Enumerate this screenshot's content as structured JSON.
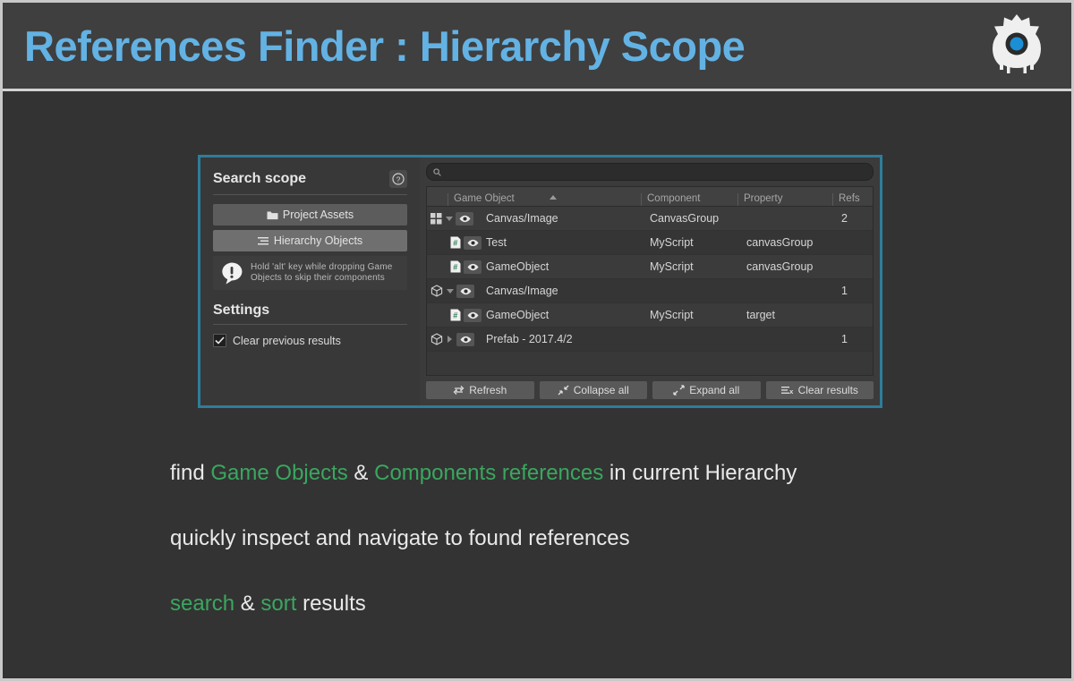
{
  "header": {
    "title": "References Finder : Hierarchy Scope",
    "title_color": "#63b2e4",
    "logo_icon": "robot-gear-head-icon",
    "logo_eye_color": "#1b8fd6"
  },
  "scope_panel": {
    "title": "Search scope",
    "help_icon": "question-mark-circle-icon",
    "buttons": [
      {
        "label": "Project Assets",
        "icon": "folder-icon",
        "selected": false
      },
      {
        "label": "Hierarchy Objects",
        "icon": "hierarchy-list-icon",
        "selected": true
      }
    ],
    "hint": {
      "icon": "exclamation-bubble-icon",
      "line1": "Hold 'alt' key while dropping Game",
      "line2": "Objects to skip their components"
    },
    "settings_title": "Settings",
    "settings": [
      {
        "label": "Clear previous results",
        "checked": true
      }
    ]
  },
  "results_panel": {
    "search": {
      "icon": "search-icon",
      "value": "",
      "placeholder": ""
    },
    "columns": [
      {
        "key": "icons",
        "label": ""
      },
      {
        "key": "gameobject",
        "label": "Game Object",
        "sorted": "asc"
      },
      {
        "key": "component",
        "label": "Component"
      },
      {
        "key": "property",
        "label": "Property"
      },
      {
        "key": "refs",
        "label": "Refs"
      }
    ],
    "rows": [
      {
        "type": "parent",
        "type_icon": "grid-squares-icon",
        "expander": "down",
        "eye_icon": "eye-icon",
        "gameobject": "Canvas/Image",
        "component": "CanvasGroup",
        "property": "",
        "refs": "2"
      },
      {
        "type": "child",
        "type_icon": "csharp-script-icon",
        "expander": "",
        "eye_icon": "eye-icon",
        "gameobject": "Test",
        "component": "MyScript",
        "property": "canvasGroup",
        "refs": ""
      },
      {
        "type": "child",
        "type_icon": "csharp-script-icon",
        "expander": "",
        "eye_icon": "eye-icon",
        "gameobject": "GameObject",
        "component": "MyScript",
        "property": "canvasGroup",
        "refs": ""
      },
      {
        "type": "parent",
        "type_icon": "cube-prefab-icon",
        "expander": "down",
        "eye_icon": "eye-icon",
        "gameobject": "Canvas/Image",
        "component": "",
        "property": "",
        "refs": "1"
      },
      {
        "type": "child",
        "type_icon": "csharp-script-icon",
        "expander": "",
        "eye_icon": "eye-icon",
        "gameobject": "GameObject",
        "component": "MyScript",
        "property": "target",
        "refs": ""
      },
      {
        "type": "parent",
        "type_icon": "cube-prefab-icon",
        "expander": "right",
        "eye_icon": "eye-icon",
        "gameobject": "Prefab - 2017.4/2",
        "component": "",
        "property": "",
        "refs": "1"
      }
    ],
    "footer_buttons": [
      {
        "label": "Refresh",
        "icon": "refresh-loop-icon"
      },
      {
        "label": "Collapse all",
        "icon": "collapse-arrows-icon"
      },
      {
        "label": "Expand all",
        "icon": "expand-arrows-icon"
      },
      {
        "label": "Clear results",
        "icon": "clear-list-x-icon"
      }
    ]
  },
  "captions": {
    "line1": {
      "pre": "find ",
      "g1": "Game Objects",
      "mid": " & ",
      "g2": "Components references",
      "post": " in current Hierarchy"
    },
    "line2": {
      "text": "quickly inspect and navigate to found references"
    },
    "line3": {
      "g1": "search",
      "mid": " & ",
      "g2": "sort",
      "post": " results"
    }
  },
  "colors": {
    "accent_border": "#2e7d99",
    "green": "#3aa75f",
    "title_blue": "#63b2e4",
    "background": "#333333"
  }
}
